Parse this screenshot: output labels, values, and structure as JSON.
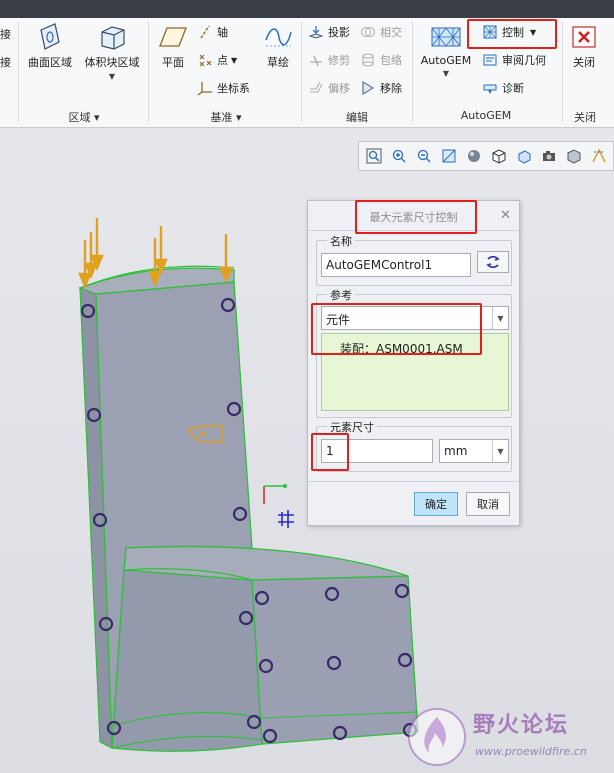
{
  "ribbon": {
    "left_partial": [
      "接",
      "接"
    ],
    "groups": {
      "region": {
        "label": "区域",
        "buttons": [
          "曲面区域",
          "体积块区域"
        ]
      },
      "datum": {
        "label": "基准",
        "plane": "平面",
        "axis": "轴",
        "point": "点",
        "csys": "坐标系",
        "sketch": "草绘"
      },
      "edit": {
        "label": "编辑",
        "project": "投影",
        "intersect": "相交",
        "trim": "修剪",
        "wrap": "包络",
        "offset": "偏移",
        "remove": "移除"
      },
      "autogem": {
        "label": "AutoGEM",
        "main": "AutoGEM",
        "control": "控制",
        "review": "审阅几何",
        "diagnose": "诊断"
      },
      "close": {
        "label": "关闭",
        "button": "关闭"
      }
    }
  },
  "dialog": {
    "title": "最大元素尺寸控制",
    "name_legend": "名称",
    "name_value": "AutoGEMControl1",
    "ref_legend": "参考",
    "ref_type": "元件",
    "ref_item": "装配：ASM0001.ASM",
    "size_legend": "元素尺寸",
    "size_value": "1",
    "unit": "mm",
    "ok": "确定",
    "cancel": "取消"
  },
  "watermark": {
    "text": "野火论坛",
    "url": "www.proewildfire.cn"
  },
  "colors": {
    "highlight": "#e0201a",
    "model_fill": "#9aa0b2",
    "model_edge": "#2fbf3a",
    "load_arrow": "#e0a020",
    "constraint": "#3a2a6a",
    "ref_list_bg": "#e7f7d5"
  }
}
